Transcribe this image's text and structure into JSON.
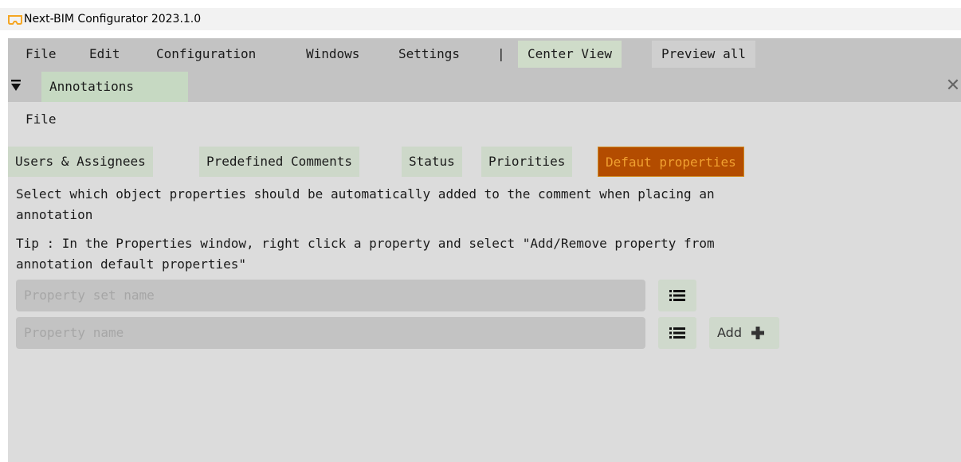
{
  "window": {
    "title": "Next-BIM Configurator 2023.1.0",
    "logo_icon": "vr-headset-icon",
    "accent": "#f5a623"
  },
  "menubar": {
    "items": [
      "File",
      "Edit",
      "Configuration",
      "Windows",
      "Settings"
    ],
    "separator": "|",
    "center_view": "Center View",
    "preview_all": "Preview all"
  },
  "panel": {
    "tab_label": "Annotations",
    "collapse_icon": "triangle-down-icon",
    "close_icon": "close-icon"
  },
  "submenu": {
    "file": "File"
  },
  "tabs": {
    "items": [
      "Users & Assignees",
      "Predefined Comments",
      "Status",
      "Priorities",
      "Defaut properties"
    ],
    "active_index": 4,
    "active_bg": "#b34c00",
    "active_fg": "#f0a030"
  },
  "content": {
    "description": "Select which object properties should be automatically added to the comment when placing an\nannotation",
    "tip": "Tip : In the Properties window, right click a property and select \"Add/Remove property from\nannotation default properties\"",
    "property_set_placeholder": "Property set name",
    "property_name_placeholder": "Property name",
    "list_icon": "list-icon",
    "add_label": "Add",
    "add_icon": "plus-icon"
  }
}
